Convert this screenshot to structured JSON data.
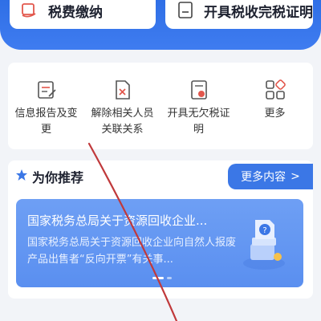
{
  "top_cards": [
    {
      "label": "税费缴纳",
      "icon": "tax-payment-icon"
    },
    {
      "label": "开具税收完税证明",
      "icon": "tax-certificate-icon"
    }
  ],
  "services": [
    {
      "label": "信息报告及变更",
      "icon": "info-report-icon"
    },
    {
      "label": "解除相关人员关联关系",
      "icon": "disassociate-icon"
    },
    {
      "label": "开具无欠税证明",
      "icon": "no-tax-arrears-certificate-icon"
    },
    {
      "label": "更多",
      "icon": "more-grid-icon"
    }
  ],
  "recommend": {
    "title": "为你推荐",
    "more_label": "更多内容",
    "banner": {
      "title": "国家税务总局关于资源回收企业...",
      "description": "国家税务总局关于资源回收企业向自然人报废产品出售者“反向开票”有关事..."
    }
  },
  "colors": {
    "primary": "#3b77e6",
    "header": "#2f6fe6",
    "banner": "#6a9cf4",
    "icon_red": "#e2574c",
    "scribble": "#c0393b"
  }
}
